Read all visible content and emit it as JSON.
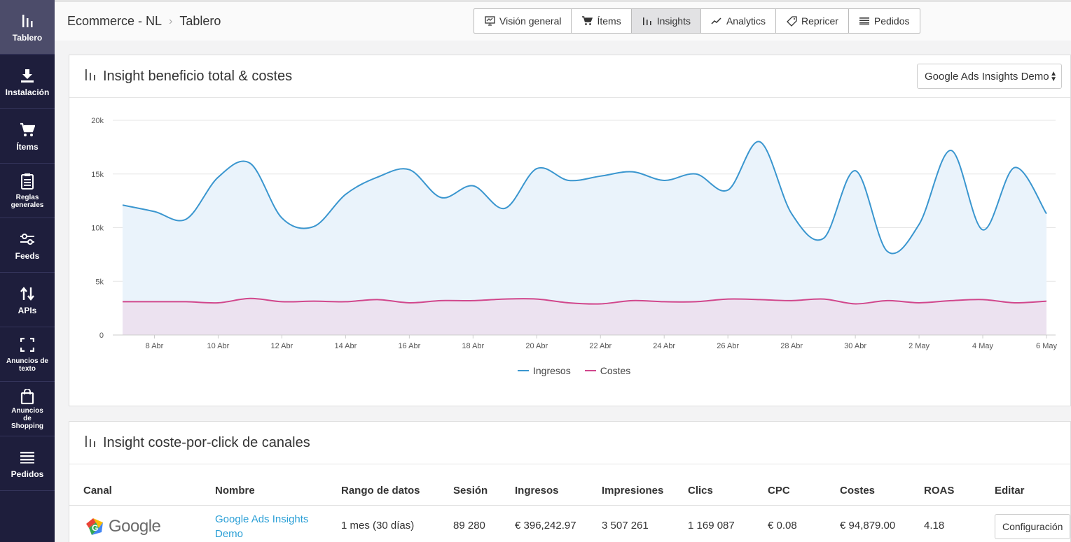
{
  "sidebar": {
    "items": [
      {
        "label": "Tablero",
        "icon": "bar-chart-icon",
        "active": true
      },
      {
        "label": "Instalación",
        "icon": "download-icon"
      },
      {
        "label": "Ítems",
        "icon": "cart-icon"
      },
      {
        "label": "Reglas generales",
        "icon": "clipboard-icon"
      },
      {
        "label": "Feeds",
        "icon": "sliders-icon"
      },
      {
        "label": "APIs",
        "icon": "arrows-updown-icon"
      },
      {
        "label": "Anuncios de texto",
        "icon": "expand-icon"
      },
      {
        "label": "Anuncios de Shopping",
        "icon": "shopping-bag-icon"
      },
      {
        "label": "Pedidos",
        "icon": "list-icon"
      }
    ]
  },
  "breadcrumb": {
    "root": "Ecommerce - NL",
    "current": "Tablero"
  },
  "tabs": [
    {
      "label": "Visión general",
      "icon": "presentation-icon"
    },
    {
      "label": "Ítems",
      "icon": "cart-icon"
    },
    {
      "label": "Insights",
      "icon": "bar-chart-icon",
      "active": true
    },
    {
      "label": "Analytics",
      "icon": "trend-icon"
    },
    {
      "label": "Repricer",
      "icon": "tag-icon"
    },
    {
      "label": "Pedidos",
      "icon": "list-icon"
    }
  ],
  "card1": {
    "title": "Insight beneficio total & costes",
    "select_value": "Google Ads Insights Demo"
  },
  "chart_data": {
    "type": "area",
    "title": "Insight beneficio total & costes",
    "x": [
      "7 Abr",
      "8 Abr",
      "9 Abr",
      "10 Abr",
      "11 Abr",
      "12 Abr",
      "13 Abr",
      "14 Abr",
      "15 Abr",
      "16 Abr",
      "17 Abr",
      "18 Abr",
      "19 Abr",
      "20 Abr",
      "21 Abr",
      "22 Abr",
      "23 Abr",
      "24 Abr",
      "25 Abr",
      "26 Abr",
      "27 Abr",
      "28 Abr",
      "29 Abr",
      "30 Abr",
      "1 May",
      "2 May",
      "3 May",
      "4 May",
      "5 May",
      "6 May"
    ],
    "tick_labels": [
      "8 Abr",
      "10 Abr",
      "12 Abr",
      "14 Abr",
      "16 Abr",
      "18 Abr",
      "20 Abr",
      "22 Abr",
      "24 Abr",
      "26 Abr",
      "28 Abr",
      "30 Abr",
      "2 May",
      "4 May",
      "6 May"
    ],
    "series": [
      {
        "name": "Ingresos",
        "color": "#3a96cf",
        "fill": "#eaf3fb",
        "values": [
          12100,
          11500,
          10800,
          14700,
          16000,
          10900,
          10100,
          13100,
          14700,
          15400,
          12800,
          13900,
          11800,
          15500,
          14400,
          14800,
          15200,
          14400,
          15000,
          13500,
          18000,
          11300,
          9000,
          15300,
          7800,
          10300,
          17200,
          9800,
          15600,
          11300
        ]
      },
      {
        "name": "Costes",
        "color": "#d1478c",
        "fill": "#ece2f0",
        "values": [
          3100,
          3100,
          3100,
          3000,
          3400,
          3100,
          3150,
          3100,
          3300,
          3000,
          3200,
          3200,
          3350,
          3350,
          3000,
          2900,
          3200,
          3100,
          3100,
          3350,
          3300,
          3200,
          3350,
          2900,
          3200,
          3000,
          3200,
          3300,
          3000,
          3150
        ]
      }
    ],
    "y_ticks": [
      "0",
      "5k",
      "10k",
      "15k",
      "20k"
    ],
    "ylim": [
      0,
      20000
    ],
    "grid": true,
    "legend": "bottom-center"
  },
  "card2": {
    "title": "Insight coste-por-click de canales"
  },
  "table": {
    "headers": [
      "Canal",
      "Nombre",
      "Rango de datos",
      "Sesión",
      "Ingresos",
      "Impresiones",
      "Clics",
      "CPC",
      "Costes",
      "ROAS",
      "Editar"
    ],
    "rows": [
      {
        "canal": "Google",
        "nombre": "Google Ads Insights Demo",
        "rango": "1 mes (30 días)",
        "sesion": "89 280",
        "ingresos": "€ 396,242.97",
        "impresiones": "3 507 261",
        "clics": "1 169 087",
        "cpc": "€ 0.08",
        "costes": "€ 94,879.00",
        "roas": "4.18",
        "editar": "Configuración"
      }
    ]
  }
}
